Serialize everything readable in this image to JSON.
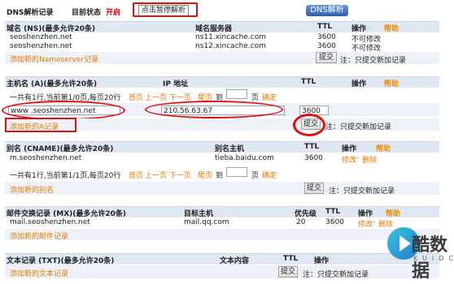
{
  "top": {
    "title": "DNS解析记录",
    "status_label": "目前状态",
    "status_value": "开启",
    "pause_link": "点击暂停解析",
    "dns_button": "DNS解析"
  },
  "ns": {
    "col_domain": "域名 (NS)(最多允许20条)",
    "col_server": "域名服务器",
    "col_ttl": "TTL",
    "col_action": "操作",
    "col_help": "帮助",
    "rows": [
      {
        "domain": "seoshenzhen.net",
        "server": "ns11.xincache.com",
        "ttl": "3600",
        "action": "不可修改"
      },
      {
        "domain": "seoshenzhen.net",
        "server": "ns12.xincache.com",
        "ttl": "3600",
        "action": "不可修改"
      }
    ],
    "add_link": "添加新的Nameserver记录",
    "submit": "提交",
    "note": "注：只提交新加记录"
  },
  "a": {
    "col_host": "主机名 (A)(最多允许20条)",
    "col_ip": "IP 地址",
    "col_ttl": "TTL",
    "col_action": "操作",
    "col_help": "帮助",
    "pager_text": "一共有1行,当前第1/0页,每页20行",
    "pager_first": "首页",
    "pager_prev": "上一页",
    "pager_next": "下一页",
    "pager_last": "尾页",
    "pager_to": "到",
    "pager_page": "页",
    "pager_go": "确定",
    "host_value": "www .seoshenzhen.net",
    "ip_value": "210.56.63.67",
    "ttl_value": "3600",
    "add_link": "添加新的A记录",
    "submit": "提交",
    "note": "注：只提交新加记录"
  },
  "cname": {
    "col_alias": "别名 (CNAME)(最多允许20条)",
    "col_host": "别名主机",
    "col_ttl": "TTL",
    "col_action": "操作",
    "col_help": "帮助",
    "row": {
      "alias": "m.seoshenzhen.net",
      "host": "tieba.baidu.com",
      "ttl": "3600",
      "edit": "修改",
      "delete": "删除"
    },
    "pager_text": "一共有1行,当前第1/1页,每页20行",
    "pager_first": "首页",
    "pager_prev": "上一页",
    "pager_next": "下一页",
    "pager_last": "尾页",
    "pager_to": "到",
    "pager_page": "页",
    "pager_go": "确定",
    "add_link": "添加新的别名",
    "submit": "提交",
    "note": "注：只提交新加记录"
  },
  "mx": {
    "col_record": "邮件交换记录 (MX)(最多允许20条)",
    "col_host": "目标主机",
    "col_priority": "优先级",
    "col_ttl": "TTL",
    "col_action": "操作",
    "col_help": "帮助",
    "row": {
      "record": "mail.seoshenzhen.net",
      "host": "mail.qq.com",
      "priority": "20",
      "ttl": "3600",
      "edit": "修改",
      "delete": "删除"
    },
    "add_link": "添加新的邮件记录"
  },
  "txt": {
    "col_record": "文本记录 (TXT)(最多允许20条)",
    "col_content": "文本内容",
    "col_ttl": "TTL",
    "col_action": "操作",
    "add_link": "添加新的文本记录",
    "submit": "提交",
    "note": "注：只提交新加记录"
  },
  "watermark": {
    "text": "酷数据",
    "sub": "KUIDC"
  },
  "colors": {
    "header_bg": "#dfe7f3",
    "strip_bg": "#eef2f8",
    "link_orange": "#e07b00",
    "annotation_red": "#e01010"
  }
}
